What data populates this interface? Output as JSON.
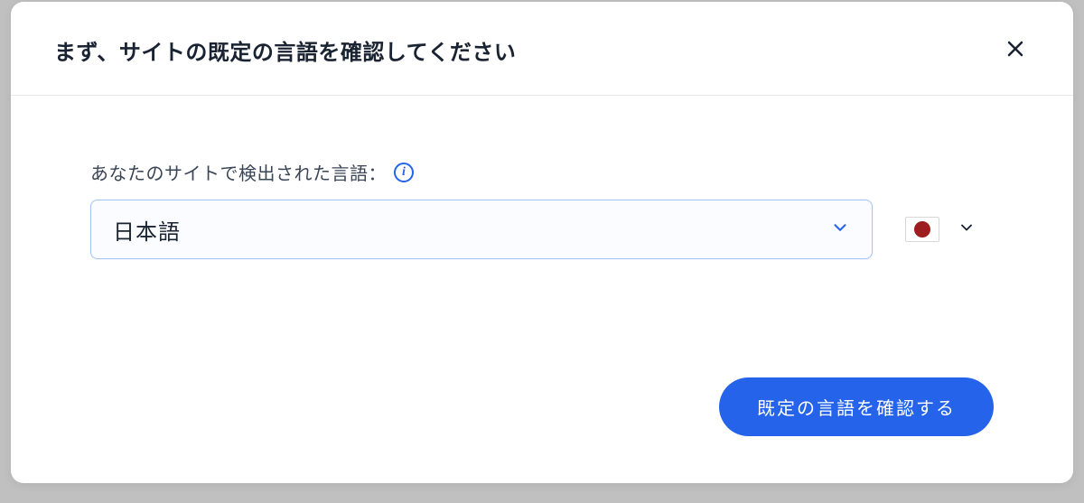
{
  "modal": {
    "title": "まず、サイトの既定の言語を確認してください",
    "field_label": "あなたのサイトで検出された言語：",
    "language_select": {
      "value": "日本語"
    },
    "flag_select": {
      "country": "Japan",
      "icon_name": "flag-japan"
    },
    "confirm_button_label": "既定の言語を確認する"
  }
}
